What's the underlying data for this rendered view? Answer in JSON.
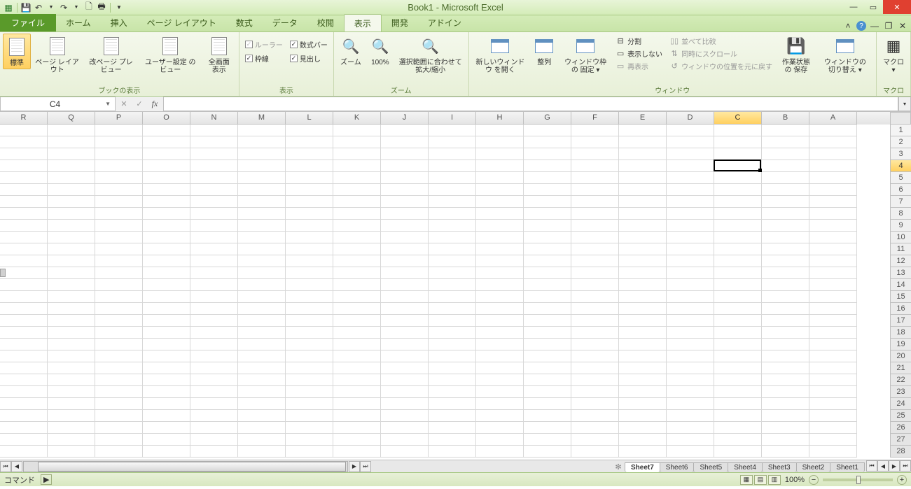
{
  "title": "Book1 - Microsoft Excel",
  "qat": {
    "save": "💾",
    "undo": "↶",
    "redo": "↷",
    "print": "🖶"
  },
  "tabs": {
    "file": "ファイル",
    "items": [
      "ホーム",
      "挿入",
      "ページ レイアウト",
      "数式",
      "データ",
      "校閲",
      "表示",
      "開発",
      "アドイン"
    ],
    "active_index": 6
  },
  "ribbon": {
    "workbook_views": {
      "label": "ブックの表示",
      "normal": "標準",
      "page_layout": "ページ\nレイアウト",
      "page_break": "改ページ\nプレビュー",
      "custom": "ユーザー設定\nのビュー",
      "full": "全画面\n表示"
    },
    "show": {
      "label": "表示",
      "ruler": "ルーラー",
      "formula_bar": "数式バー",
      "gridlines": "枠線",
      "headings": "見出し"
    },
    "zoom": {
      "label": "ズーム",
      "zoom": "ズーム",
      "hundred": "100%",
      "selection": "選択範囲に合わせて\n拡大/縮小"
    },
    "window": {
      "label": "ウィンドウ",
      "new": "新しいウィンドウ\nを開く",
      "arrange": "整列",
      "freeze": "ウィンドウ枠の\n固定 ▾",
      "split": "分割",
      "hide": "表示しない",
      "unhide": "再表示",
      "side": "並べて比較",
      "sync": "同時にスクロール",
      "reset": "ウィンドウの位置を元に戻す",
      "save_ws": "作業状態の\n保存",
      "switch": "ウィンドウの\n切り替え ▾"
    },
    "macro": {
      "label": "マクロ",
      "btn": "マクロ\n▾"
    }
  },
  "namebox": "C4",
  "columns": [
    "R",
    "Q",
    "P",
    "O",
    "N",
    "M",
    "L",
    "K",
    "J",
    "I",
    "H",
    "G",
    "F",
    "E",
    "D",
    "C",
    "B",
    "A"
  ],
  "selected_col": "C",
  "rows_count": 28,
  "selected_row": 4,
  "sheets": [
    "Sheet7",
    "Sheet6",
    "Sheet5",
    "Sheet4",
    "Sheet3",
    "Sheet2",
    "Sheet1"
  ],
  "active_sheet": "Sheet7",
  "status": {
    "mode": "コマンド",
    "zoom": "100%"
  }
}
